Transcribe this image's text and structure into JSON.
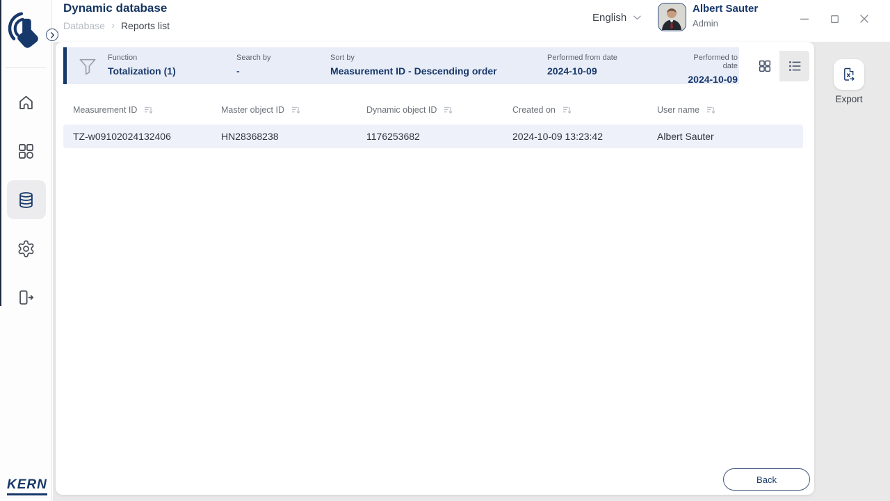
{
  "app": {
    "title": "Dynamic database",
    "breadcrumb_parent": "Database",
    "breadcrumb_sep": "›",
    "breadcrumb_current": "Reports list",
    "language": "English",
    "user_name": "Albert Sauter",
    "user_role": "Admin",
    "brand": "KERN"
  },
  "filter_bar": {
    "items": [
      {
        "label": "Function",
        "value": "Totalization (1)"
      },
      {
        "label": "Search by",
        "value": "-"
      },
      {
        "label": "Sort by",
        "value": "Measurement ID - Descending order"
      },
      {
        "label": "Performed from date",
        "value": "2024-10-09"
      },
      {
        "label": "Performed to date",
        "value": "2024-10-09"
      }
    ]
  },
  "table": {
    "columns": [
      "Measurement ID",
      "Master object ID",
      "Dynamic object ID",
      "Created on",
      "User name"
    ],
    "rows": [
      [
        "TZ-w09102024132406",
        "HN28368238",
        "1176253682",
        "2024-10-09 13:23:42",
        "Albert Sauter"
      ]
    ]
  },
  "actions": {
    "export": "Export",
    "back": "Back"
  },
  "icons": {
    "sidebar": [
      "touch-logo",
      "home",
      "apps",
      "database",
      "settings",
      "logout"
    ],
    "filter": "funnel",
    "view_modes": [
      "grid",
      "list"
    ],
    "column_sort": "sort-descending",
    "export": "file-export",
    "window": [
      "minimize",
      "maximize",
      "close"
    ]
  },
  "colors": {
    "primary": "#17386a",
    "filter_bg": "#e9edf8",
    "row_bg": "#eef1f9",
    "rail_bg": "#e9e9ea"
  }
}
